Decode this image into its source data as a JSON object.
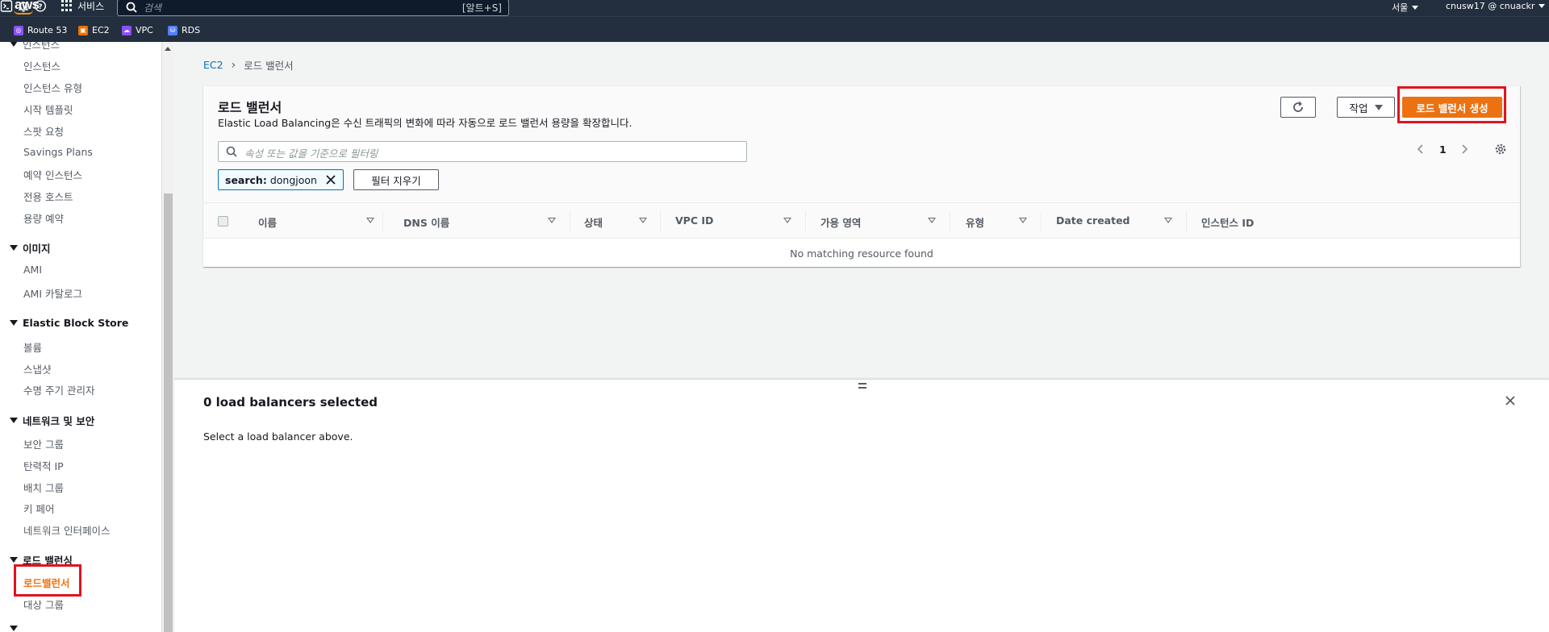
{
  "topnav": {
    "logo": "aws",
    "services_label": "서비스",
    "search_placeholder": "검색",
    "search_shortcut": "[알트+S]",
    "region": "서울",
    "account": "cnusw17 @ cnuackr"
  },
  "favorites": [
    {
      "label": "Route 53",
      "color": "#8c4fff"
    },
    {
      "label": "EC2",
      "color": "#ed7100"
    },
    {
      "label": "VPC",
      "color": "#8c4fff"
    },
    {
      "label": "RDS",
      "color": "#527fff"
    }
  ],
  "sidebar": {
    "partial_top": "인스턴스",
    "instances_items": [
      "인스턴스",
      "인스턴스 유형",
      "시작 템플릿",
      "스팟 요청",
      "Savings Plans",
      "예약 인스턴스",
      "전용 호스트",
      "용량 예약"
    ],
    "images_heading": "이미지",
    "images_items": [
      "AMI",
      "AMI 카탈로그"
    ],
    "ebs_heading": "Elastic Block Store",
    "ebs_items": [
      "볼륨",
      "스냅샷",
      "수명 주기 관리자"
    ],
    "network_heading": "네트워크 및 보안",
    "network_items": [
      "보안 그룹",
      "탄력적 IP",
      "배치 그룹",
      "키 페어",
      "네트워크 인터페이스"
    ],
    "lb_heading": "로드 밸런싱",
    "lb_items": [
      "로드밸런서",
      "대상 그룹"
    ],
    "active_color": "#ec7211"
  },
  "breadcrumb": {
    "root": "EC2",
    "current": "로드 밸런서"
  },
  "panel": {
    "title": "로드 밸런서",
    "description": "Elastic Load Balancing은 수신 트래픽의 변화에 따라 자동으로 로드 밸런서 용량을 확장합니다.",
    "actions_label": "작업",
    "create_label": "로드 밸런서 생성",
    "filter_placeholder": "속성 또는 값을 기준으로 필터링",
    "token_key": "search:",
    "token_value": "dongjoon",
    "clear_filters_label": "필터 지우기",
    "page_number": "1",
    "columns": [
      "이름",
      "DNS 이름",
      "상태",
      "VPC ID",
      "가용 영역",
      "유형",
      "Date created",
      "인스턴스 ID"
    ],
    "empty_message": "No matching resource found"
  },
  "split_panel": {
    "title": "0 load balancers selected",
    "description": "Select a load balancer above."
  },
  "colors": {
    "nav_bg": "#232f3e",
    "primary": "#ec7211",
    "link": "#0073bb",
    "highlight": "#e0141e"
  }
}
